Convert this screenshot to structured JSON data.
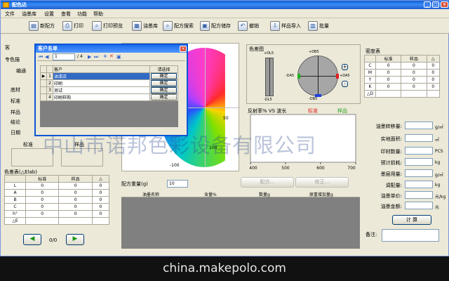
{
  "window": {
    "title": "配色达"
  },
  "menu": [
    "文件",
    "油墨库",
    "设置",
    "查看",
    "功能",
    "帮助"
  ],
  "toolbar": [
    {
      "label": "新配方",
      "icon": "new-doc-icon"
    },
    {
      "label": "打印",
      "icon": "printer-icon"
    },
    {
      "label": "打印预览",
      "icon": "print-preview-icon"
    },
    {
      "label": "油墨库",
      "icon": "ink-library-icon"
    },
    {
      "label": "配方搜索",
      "icon": "search-icon"
    },
    {
      "label": "配方储存",
      "icon": "save-icon"
    },
    {
      "label": "撤销",
      "icon": "undo-icon"
    },
    {
      "label": "样品导入",
      "icon": "import-icon"
    },
    {
      "label": "批量",
      "icon": "batch-icon"
    }
  ],
  "left": {
    "labels": [
      "客",
      "专色描",
      "编通",
      "底材",
      "标准",
      "样品",
      "结论",
      "日期"
    ],
    "standard_label": "标准",
    "sample_label": "样品",
    "color_diff_table": {
      "title": "色差表(△Elab)",
      "headers": [
        "",
        "标准",
        "样品",
        "△"
      ],
      "rows": [
        [
          "L",
          "0",
          "0",
          "0"
        ],
        [
          "A",
          "0",
          "0",
          "0"
        ],
        [
          "B",
          "0",
          "0",
          "0"
        ],
        [
          "C",
          "0",
          "0",
          "0"
        ],
        [
          "h°",
          "0",
          "0",
          "0"
        ],
        [
          "△E",
          "",
          "",
          ""
        ]
      ]
    },
    "nav": {
      "prev": "◀",
      "next": "▶",
      "page": "0/0"
    }
  },
  "dialog": {
    "title": "客户名单",
    "nav_counter": "1",
    "nav_total": "/ 4",
    "headers": [
      "",
      "",
      "客户",
      "请选择"
    ],
    "rows": [
      {
        "num": "1",
        "name": "油漆店",
        "btn": "确定",
        "selected": true
      },
      {
        "num": "2",
        "name": "印刷",
        "btn": "确定",
        "selected": false
      },
      {
        "num": "3",
        "name": "测试",
        "btn": "确定",
        "selected": false
      },
      {
        "num": "4",
        "name": "印刷样购",
        "btn": "确定",
        "selected": false
      }
    ]
  },
  "center": {
    "wheel_tick_50": "50",
    "wheel_tick_100": "100",
    "wheel_tick_neg100": "-100",
    "formula_weight_label": "配方重量(g)",
    "formula_weight_value": "10",
    "formula_button": "配方...",
    "modify_button": "修正...",
    "formula_table_headers": [
      "",
      "油墨名称",
      "含量%",
      "数量g",
      "原重增加量g"
    ]
  },
  "color_diff_plot": {
    "title": "色差图",
    "top_a": "+DL5",
    "bottom_a": "-DL5",
    "top_b": "+DB5",
    "bottom_b": "-DB5",
    "left_b": "-DA5",
    "right_b": "+DA5",
    "plus": "+",
    "minus": "-"
  },
  "chart_data": {
    "type": "line",
    "title": "反射率% VS 波长",
    "legend": [
      "标准",
      "样品"
    ],
    "xlim": [
      400,
      700
    ],
    "x_ticks": [
      "400",
      "500",
      "600",
      "700"
    ],
    "series": []
  },
  "density_table": {
    "title": "密度表",
    "headers": [
      "",
      "标准",
      "样品",
      "△"
    ],
    "rows": [
      [
        "C",
        "0",
        "0",
        "0"
      ],
      [
        "M",
        "0",
        "0",
        "0"
      ],
      [
        "Y",
        "0",
        "0",
        "0"
      ],
      [
        "K",
        "0",
        "0",
        "0"
      ],
      [
        "△D",
        "",
        "",
        ""
      ]
    ]
  },
  "right_form": {
    "fields": [
      {
        "label": "油墨转移量:",
        "unit": "g/㎡"
      },
      {
        "label": "实地面积:",
        "unit": "㎡"
      },
      {
        "label": "印材数量:",
        "unit": "PCS"
      },
      {
        "label": "预计损耗:",
        "unit": "kg"
      },
      {
        "label": "墨层用量:",
        "unit": "g/㎡"
      },
      {
        "label": "调配量:",
        "unit": "kg"
      },
      {
        "label": "油墨单价:",
        "unit": "元/kg"
      },
      {
        "label": "油墨金额:",
        "unit": "元"
      }
    ],
    "calc_button": "计 算",
    "remarks_label": "备注:"
  },
  "watermark": "中山市诺邦色彩设备有限公司",
  "footer": "china.makepolo.com",
  "colors": {
    "title_bar": "#0a5fd8",
    "accent_blue": "#2f5fd0",
    "diff_circle": "#a6a6a6",
    "legend_standard": "#e02020",
    "legend_sample": "#20a020"
  }
}
